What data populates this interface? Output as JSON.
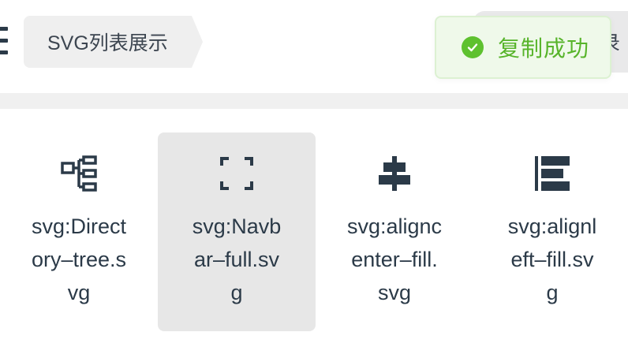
{
  "header": {
    "breadcrumb": "SVG列表展示",
    "right_tag_fragment": "录"
  },
  "toast": {
    "message": "复制成功",
    "icon": "check-circle-icon",
    "color": "#57b42a"
  },
  "icons": [
    {
      "label": "svg:Direct\nory–tree.s\nvg",
      "icon": "directory-tree-icon",
      "selected": false
    },
    {
      "label": "svg:Navb\nar–full.sv\ng",
      "icon": "navbar-full-icon",
      "selected": true
    },
    {
      "label": "svg:alignc\nenter–fill.\nsvg",
      "icon": "aligncenter-fill-icon",
      "selected": false
    },
    {
      "label": "svg:alignl\neft–fill.sv\ng",
      "icon": "alignleft-fill-icon",
      "selected": false
    }
  ],
  "colors": {
    "icon": "#2b3a48",
    "selected_bg": "#e7e7e7",
    "toast_bg": "#eff9ea"
  }
}
